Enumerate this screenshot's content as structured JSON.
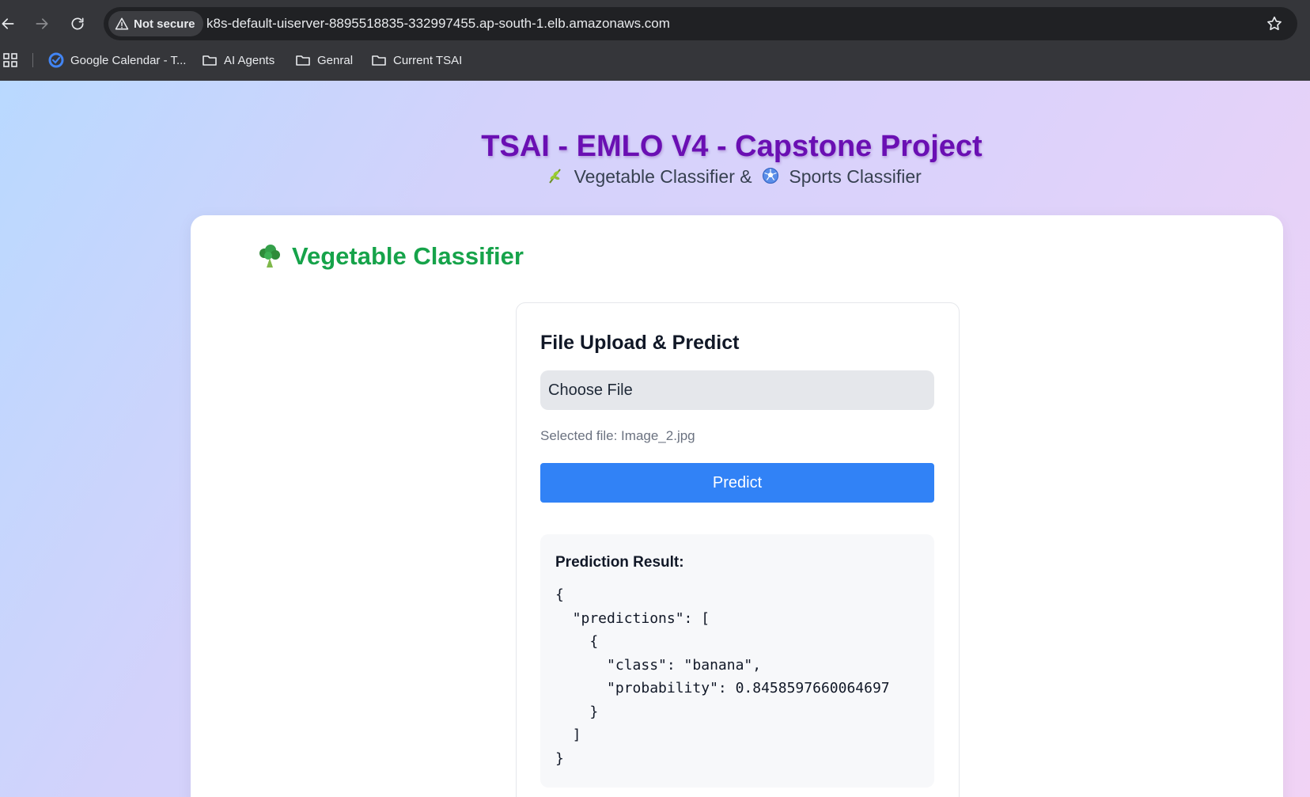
{
  "browser": {
    "security_label": "Not secure",
    "url": "k8s-default-uiserver-8895518835-332997455.ap-south-1.elb.amazonaws.com",
    "bookmarks": [
      {
        "label": "Google Calendar - T...",
        "icon": "google-calendar-icon"
      },
      {
        "label": "AI Agents",
        "icon": "folder-icon"
      },
      {
        "label": "Genral",
        "icon": "folder-icon"
      },
      {
        "label": "Current TSAI",
        "icon": "folder-icon"
      }
    ]
  },
  "header": {
    "title": "TSAI - EMLO V4 - Capstone Project",
    "subtitle_part1": "Vegetable Classifier &",
    "subtitle_part2": "Sports Classifier",
    "subtitle_icons": [
      "herb-icon",
      "soccer-ball-icon"
    ]
  },
  "vegetable_section": {
    "title": "Vegetable Classifier",
    "icon": "broccoli-icon",
    "upload_card": {
      "heading": "File Upload & Predict",
      "file_button_label": "Choose File",
      "selected_file_text": "Selected file: Image_2.jpg",
      "predict_label": "Predict",
      "result_heading": "Prediction Result:",
      "result_json": "{\n  \"predictions\": [\n    {\n      \"class\": \"banana\",\n      \"probability\": 0.8458597660064697\n    }\n  ]\n}"
    }
  },
  "colors": {
    "title_purple": "#6a0fb3",
    "section_green": "#16a34a",
    "predict_blue": "#3182f6"
  }
}
